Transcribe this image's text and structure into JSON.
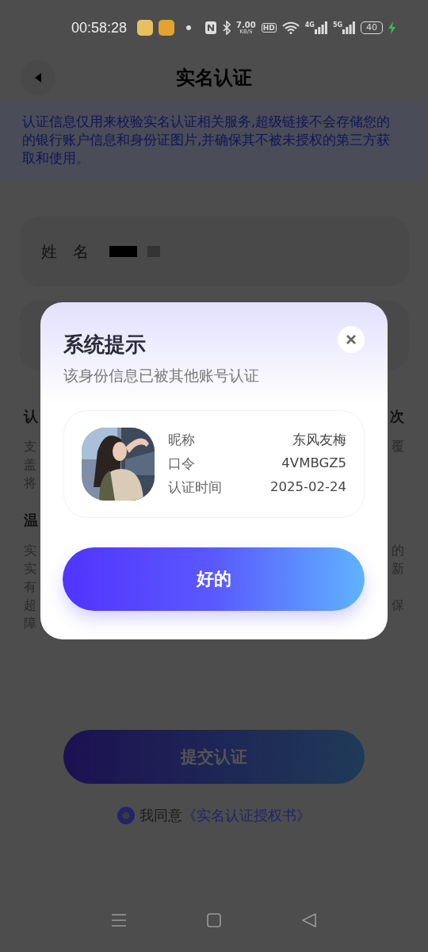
{
  "status_bar": {
    "time": "00:58:28",
    "speed": "7.00",
    "speed_unit": "KB/S",
    "hd": "HD",
    "networks": [
      "4G",
      "5G"
    ],
    "battery": "40",
    "charging": true
  },
  "header": {
    "title": "实名认证"
  },
  "notice": "认证信息仅用来校验实名认证相关服务,超级链接不会存储您的的银行账户信息和身份证图片,并确保其不被未授权的第三方获取和使用。",
  "form": {
    "name_label": "姓　名",
    "name_redacted": true
  },
  "sections": [
    {
      "title_start": "认",
      "title_end": "次",
      "lines": [
        {
          "start": "支",
          "end": "覆"
        },
        {
          "start": "盖"
        },
        {
          "start": "将"
        }
      ]
    },
    {
      "title_start": "温",
      "lines": [
        {
          "start": "实",
          "end": "的"
        },
        {
          "start": "实",
          "end": "新"
        },
        {
          "start": "有"
        },
        {
          "start": "超",
          "end": "保"
        },
        {
          "start": "障"
        }
      ]
    }
  ],
  "submit_button": "提交认证",
  "agreement": {
    "checked": true,
    "text": "我同意",
    "link": "《实名认证授权书》"
  },
  "dialog": {
    "title": "系统提示",
    "subtitle": "该身份信息已被其他账号认证",
    "profile": {
      "fields": [
        {
          "label": "昵称",
          "value": "东风友梅"
        },
        {
          "label": "口令",
          "value": "4VMBGZ5"
        },
        {
          "label": "认证时间",
          "value": "2025-02-24"
        }
      ]
    },
    "ok_button": "好的"
  }
}
